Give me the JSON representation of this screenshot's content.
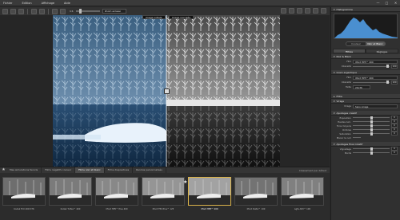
{
  "menu": [
    "Fichier",
    "Edition",
    "Affichage",
    "Aide"
  ],
  "window_controls": [
    "—",
    "□",
    "✕"
  ],
  "toolbar": {
    "zoom_value": "1:1",
    "zoom_select": "Zoom enlassi"
  },
  "compare_tags": {
    "left": "Image Initiale",
    "right": "Image Corrigée"
  },
  "panel": {
    "histogram_title": "Histogramme",
    "mode_toggle": [
      "Couleur",
      "Noir et Blanc"
    ],
    "mode_active": 1,
    "tabs": [
      "Filtres",
      "Réglages"
    ],
    "tab_active": 0,
    "sections": {
      "bw_film": {
        "title": "Noir & Blanc",
        "type_label": "Film",
        "type_value": "Ilford HP5™ 400",
        "intensity_label": "Intensité",
        "intensity_value": "100"
      },
      "grain": {
        "title": "Grain argentique",
        "film_label": "Film",
        "film_value": "Ilford HP5™ 400",
        "intensity_label": "Intensité",
        "intensity_value": "100",
        "size_label": "Taille",
        "size_value": "24x36"
      },
      "filter": {
        "title": "Filtre"
      },
      "toning": {
        "title": "Virage",
        "type_label": "Virage",
        "type_value": "Sans virage"
      },
      "sel_tone": {
        "title": "Ajustages créatif",
        "rows": [
          {
            "label": "Exposition",
            "value": "0"
          },
          {
            "label": "Hautes lum.",
            "value": "0"
          },
          {
            "label": "Tons moyens",
            "value": "0"
          },
          {
            "label": "Ombres",
            "value": "0"
          },
          {
            "label": "Saturation",
            "value": "0"
          },
          {
            "label": "Placer le noir",
            "value": ""
          }
        ]
      },
      "creative2": {
        "title": "Ajustages final créatif",
        "rows": [
          {
            "label": "Vignetage",
            "value": "0"
          },
          {
            "label": "Bords",
            "value": "0"
          }
        ]
      }
    }
  },
  "bottom_tabs": [
    "Mes simulations favoris",
    "Films négatifs couleur",
    "Films noir et blanc",
    "Films diapositives",
    "Rendus personnalisés"
  ],
  "bottom_tab_active": 2,
  "sort_label": "Classement par défaut",
  "thumbnails": [
    {
      "caption": "Kodak TriX 400 D76"
    },
    {
      "caption": "Kodak T-Max™ 400"
    },
    {
      "caption": "Ilford HP5™ Plus 400"
    },
    {
      "caption": "Ilford FP4 Plus™ 125"
    },
    {
      "caption": "Ilford HP5™ 400"
    },
    {
      "caption": "Ilford Delta™ 100"
    },
    {
      "caption": "Agfa APX™ 100"
    }
  ],
  "thumb_selected": 4,
  "colors": {
    "accent_selected": "#d9b24a",
    "panel": "#303030",
    "background": "#2a2a2a"
  }
}
